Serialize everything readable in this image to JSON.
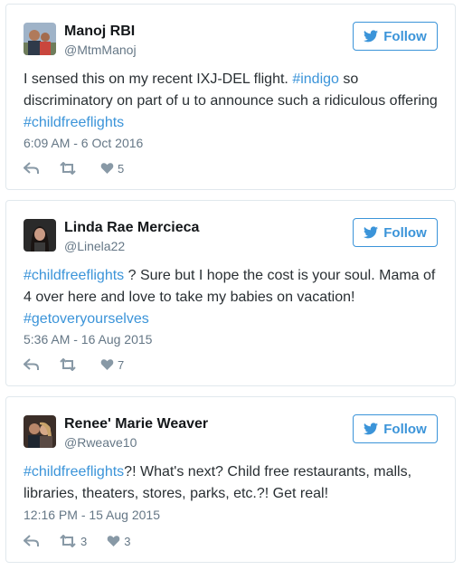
{
  "colors": {
    "link": "#3b94d9",
    "border": "#e1e8ed",
    "meta": "#657786",
    "icon": "#8899a6"
  },
  "tweets": [
    {
      "name": "Manoj RBI",
      "handle": "@MtmManoj",
      "follow_label": "Follow",
      "text_parts": [
        {
          "t": "I sensed this on my recent IXJ-DEL flight. ",
          "tag": false
        },
        {
          "t": "#indigo",
          "tag": true
        },
        {
          "t": " so discriminatory on part of u to announce such a ridiculous offering ",
          "tag": false
        },
        {
          "t": "#childfreeflights",
          "tag": true
        }
      ],
      "time": "6:09 AM - 6 Oct 2016",
      "retweets": "",
      "likes": "5"
    },
    {
      "name": "Linda Rae Mercieca",
      "handle": "@Linela22",
      "follow_label": "Follow",
      "text_parts": [
        {
          "t": "#childfreeflights",
          "tag": true
        },
        {
          "t": " ? Sure but I hope the cost is your soul. Mama of 4 over here and love to take my babies on vacation! ",
          "tag": false
        },
        {
          "t": "#getoveryourselves",
          "tag": true
        }
      ],
      "time": "5:36 AM - 16 Aug 2015",
      "retweets": "",
      "likes": "7"
    },
    {
      "name": "Renee' Marie Weaver",
      "handle": "@Rweave10",
      "follow_label": "Follow",
      "text_parts": [
        {
          "t": "#childfreeflights",
          "tag": true
        },
        {
          "t": "?! What's next? Child free restaurants, malls, libraries, theaters, stores, parks, etc.?! Get real!",
          "tag": false
        }
      ],
      "time": "12:16 PM - 15 Aug 2015",
      "retweets": "3",
      "likes": "3"
    }
  ],
  "icons": {
    "follow": "twitter-bird-icon",
    "reply": "reply-icon",
    "retweet": "retweet-icon",
    "like": "heart-icon"
  }
}
